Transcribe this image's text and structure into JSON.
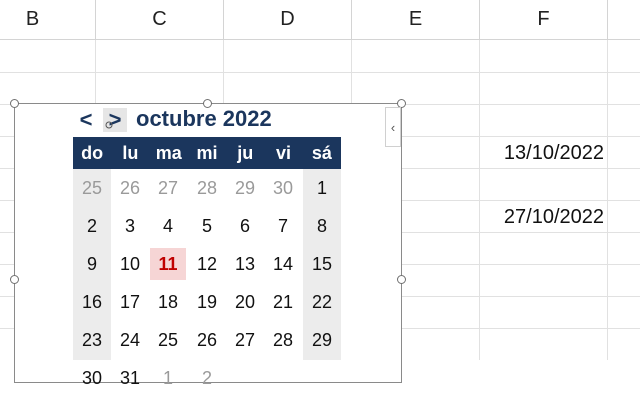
{
  "columns": [
    "B",
    "C",
    "D",
    "E",
    "F"
  ],
  "cells": {
    "F_row1": "13/10/2022",
    "F_row2": "27/10/2022"
  },
  "calendar": {
    "prev_label": "<",
    "next_label": ">",
    "collapse_label": "‹",
    "month_title": "octubre 2022",
    "weekdays": [
      "do",
      "lu",
      "ma",
      "mi",
      "ju",
      "vi",
      "sá"
    ],
    "weeks": [
      [
        "25",
        "26",
        "27",
        "28",
        "29",
        "30",
        "1"
      ],
      [
        "2",
        "3",
        "4",
        "5",
        "6",
        "7",
        "8"
      ],
      [
        "9",
        "10",
        "11",
        "12",
        "13",
        "14",
        "15"
      ],
      [
        "16",
        "17",
        "18",
        "19",
        "20",
        "21",
        "22"
      ],
      [
        "23",
        "24",
        "25",
        "26",
        "27",
        "28",
        "29"
      ],
      [
        "30",
        "31",
        "1",
        "2",
        "",
        "",
        ""
      ]
    ],
    "today": "11",
    "colors": {
      "header_bg": "#1b365d",
      "today_bg": "#f6d5d5",
      "today_text": "#c00000",
      "weekend_bg": "#ececec"
    }
  }
}
